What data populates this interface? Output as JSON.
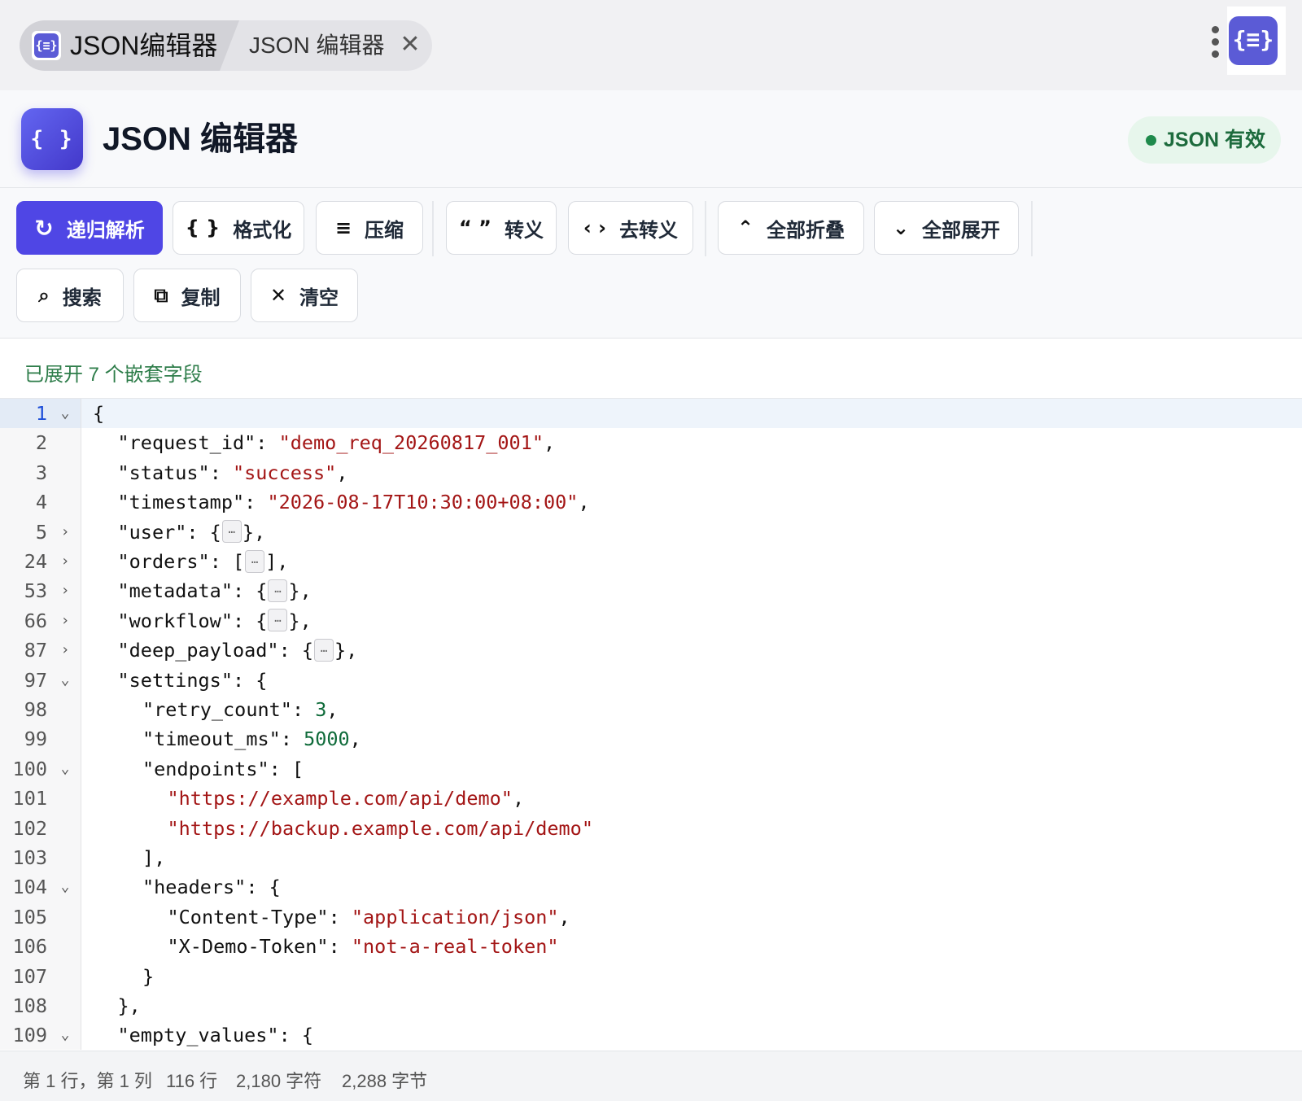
{
  "window": {
    "tabs": [
      {
        "label": "JSON编辑器",
        "icon": "json-braces-icon",
        "active": true
      },
      {
        "label": "JSON 编辑器",
        "icon": "close-icon",
        "active": false
      }
    ],
    "extension_icon": "json-braces-icon"
  },
  "header": {
    "logo_text": "{ }",
    "title": "JSON 编辑器",
    "status_badge": "JSON 有效",
    "status_color": "#1f8a4c"
  },
  "toolbar": {
    "buttons": [
      {
        "id": "recursive-parse",
        "icon": "↻",
        "icon_name": "refresh-icon",
        "label": "递归解析",
        "primary": true
      },
      {
        "id": "format",
        "icon": "{ }",
        "icon_name": "braces-icon",
        "label": "格式化"
      },
      {
        "id": "compress",
        "icon": "≡",
        "icon_name": "lines-icon",
        "label": "压缩"
      },
      {
        "id": "escape",
        "icon": "“ ”",
        "icon_name": "quotes-icon",
        "label": "转义"
      },
      {
        "id": "unescape",
        "icon": "‹ ›",
        "icon_name": "angle-brackets-icon",
        "label": "去转义"
      },
      {
        "id": "collapse-all",
        "icon": "⌃",
        "icon_name": "chevron-up-icon",
        "label": "全部折叠"
      },
      {
        "id": "expand-all",
        "icon": "⌄",
        "icon_name": "chevron-down-icon",
        "label": "全部展开"
      },
      {
        "id": "search",
        "icon": "⌕",
        "icon_name": "search-icon",
        "label": "搜索"
      },
      {
        "id": "copy",
        "icon": "⧉",
        "icon_name": "copy-icon",
        "label": "复制"
      },
      {
        "id": "clear",
        "icon": "✕",
        "icon_name": "close-icon",
        "label": "清空"
      }
    ],
    "accent_color": "#4f46e5"
  },
  "message": "已展开 7 个嵌套字段",
  "editor": {
    "lines": [
      {
        "no": "1",
        "fold": "open",
        "indent": 0,
        "parts": [
          [
            "p",
            "{"
          ]
        ]
      },
      {
        "no": "2",
        "indent": 1,
        "parts": [
          [
            "k",
            "\"request_id\""
          ],
          [
            "p",
            ": "
          ],
          [
            "s",
            "\"demo_req_20260817_001\""
          ],
          [
            "p",
            ","
          ]
        ]
      },
      {
        "no": "3",
        "indent": 1,
        "parts": [
          [
            "k",
            "\"status\""
          ],
          [
            "p",
            ": "
          ],
          [
            "s",
            "\"success\""
          ],
          [
            "p",
            ","
          ]
        ]
      },
      {
        "no": "4",
        "indent": 1,
        "parts": [
          [
            "k",
            "\"timestamp\""
          ],
          [
            "p",
            ": "
          ],
          [
            "s",
            "\"2026-08-17T10:30:00+08:00\""
          ],
          [
            "p",
            ","
          ]
        ]
      },
      {
        "no": "5",
        "fold": "closed",
        "indent": 1,
        "parts": [
          [
            "k",
            "\"user\""
          ],
          [
            "p",
            ": {"
          ],
          [
            "ph",
            "…"
          ],
          [
            "p",
            "},"
          ]
        ]
      },
      {
        "no": "24",
        "fold": "closed",
        "indent": 1,
        "parts": [
          [
            "k",
            "\"orders\""
          ],
          [
            "p",
            ": ["
          ],
          [
            "ph",
            "…"
          ],
          [
            "p",
            "],"
          ]
        ]
      },
      {
        "no": "53",
        "fold": "closed",
        "indent": 1,
        "parts": [
          [
            "k",
            "\"metadata\""
          ],
          [
            "p",
            ": {"
          ],
          [
            "ph",
            "…"
          ],
          [
            "p",
            "},"
          ]
        ]
      },
      {
        "no": "66",
        "fold": "closed",
        "indent": 1,
        "parts": [
          [
            "k",
            "\"workflow\""
          ],
          [
            "p",
            ": {"
          ],
          [
            "ph",
            "…"
          ],
          [
            "p",
            "},"
          ]
        ]
      },
      {
        "no": "87",
        "fold": "closed",
        "indent": 1,
        "parts": [
          [
            "k",
            "\"deep_payload\""
          ],
          [
            "p",
            ": {"
          ],
          [
            "ph",
            "…"
          ],
          [
            "p",
            "},"
          ]
        ]
      },
      {
        "no": "97",
        "fold": "open",
        "indent": 1,
        "parts": [
          [
            "k",
            "\"settings\""
          ],
          [
            "p",
            ": {"
          ]
        ]
      },
      {
        "no": "98",
        "indent": 2,
        "parts": [
          [
            "k",
            "\"retry_count\""
          ],
          [
            "p",
            ": "
          ],
          [
            "n",
            "3"
          ],
          [
            "p",
            ","
          ]
        ]
      },
      {
        "no": "99",
        "indent": 2,
        "parts": [
          [
            "k",
            "\"timeout_ms\""
          ],
          [
            "p",
            ": "
          ],
          [
            "n",
            "5000"
          ],
          [
            "p",
            ","
          ]
        ]
      },
      {
        "no": "100",
        "fold": "open",
        "indent": 2,
        "parts": [
          [
            "k",
            "\"endpoints\""
          ],
          [
            "p",
            ": ["
          ]
        ]
      },
      {
        "no": "101",
        "indent": 3,
        "parts": [
          [
            "s",
            "\"https://example.com/api/demo\""
          ],
          [
            "p",
            ","
          ]
        ]
      },
      {
        "no": "102",
        "indent": 3,
        "parts": [
          [
            "s",
            "\"https://backup.example.com/api/demo\""
          ]
        ]
      },
      {
        "no": "103",
        "indent": 2,
        "parts": [
          [
            "p",
            "],"
          ]
        ]
      },
      {
        "no": "104",
        "fold": "open",
        "indent": 2,
        "parts": [
          [
            "k",
            "\"headers\""
          ],
          [
            "p",
            ": {"
          ]
        ]
      },
      {
        "no": "105",
        "indent": 3,
        "parts": [
          [
            "k",
            "\"Content-Type\""
          ],
          [
            "p",
            ": "
          ],
          [
            "s",
            "\"application/json\""
          ],
          [
            "p",
            ","
          ]
        ]
      },
      {
        "no": "106",
        "indent": 3,
        "parts": [
          [
            "k",
            "\"X-Demo-Token\""
          ],
          [
            "p",
            ": "
          ],
          [
            "s",
            "\"not-a-real-token\""
          ]
        ]
      },
      {
        "no": "107",
        "indent": 2,
        "parts": [
          [
            "p",
            "}"
          ]
        ]
      },
      {
        "no": "108",
        "indent": 1,
        "parts": [
          [
            "p",
            "},"
          ]
        ]
      },
      {
        "no": "109",
        "fold": "open",
        "indent": 1,
        "parts": [
          [
            "k",
            "\"empty_values\""
          ],
          [
            "p",
            ": {"
          ]
        ]
      }
    ]
  },
  "statusbar": {
    "position": "第 1 行，第 1 列",
    "lines": "116 行",
    "chars": "2,180 字符",
    "bytes": "2,288 字节"
  }
}
